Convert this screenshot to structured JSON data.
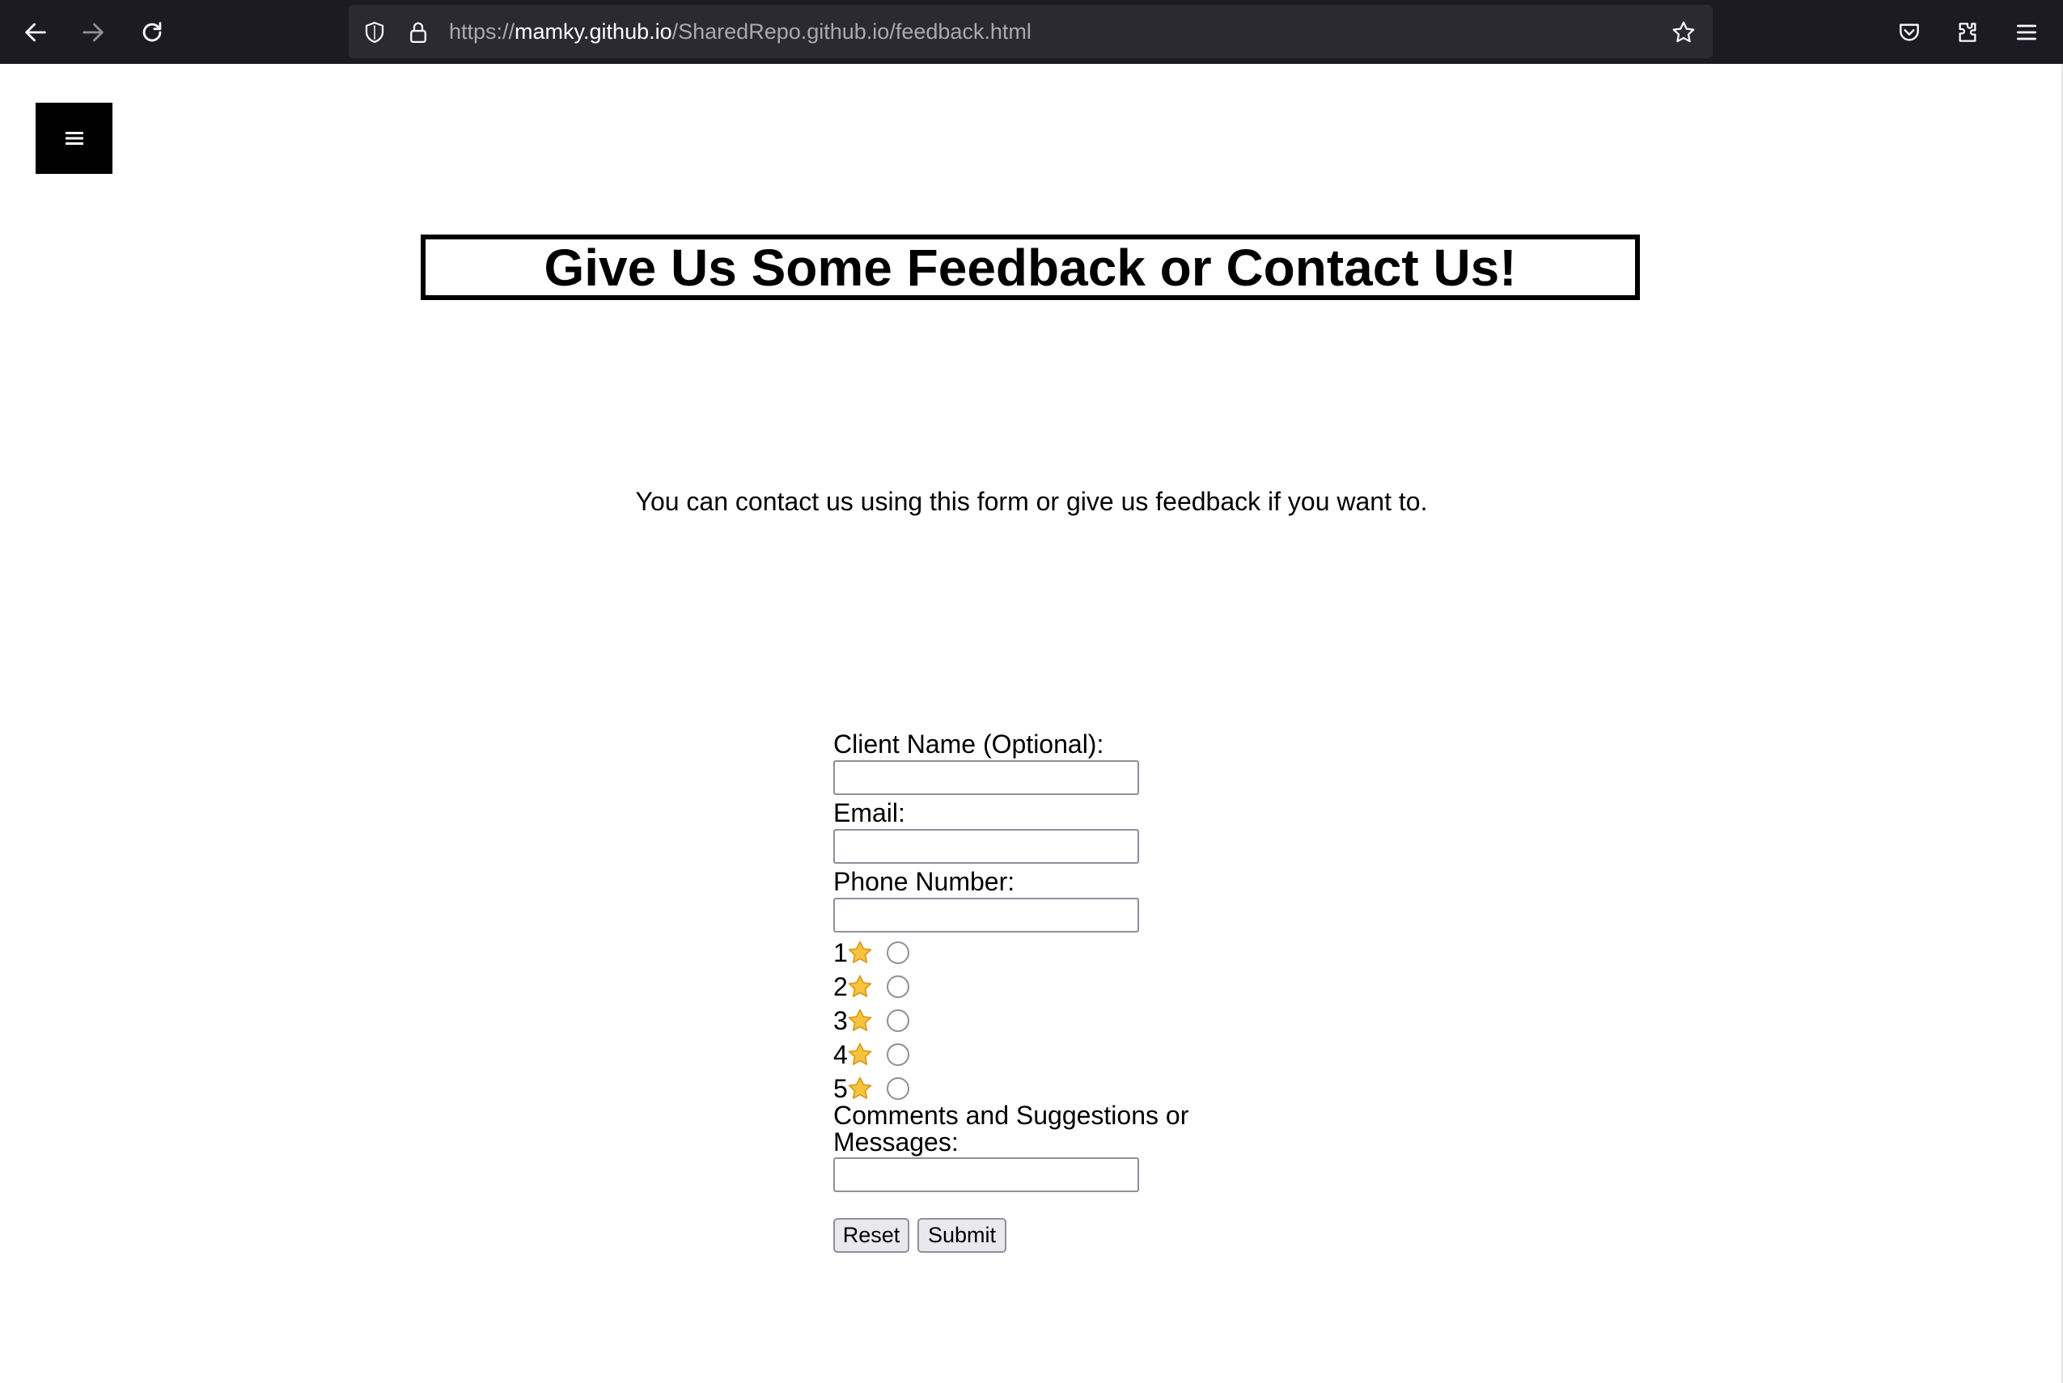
{
  "browser": {
    "url_scheme": "https://",
    "url_domain": "mamky.github.io",
    "url_path": "/SharedRepo.github.io/feedback.html"
  },
  "page": {
    "menu_icon": "hamburger-icon",
    "title": "Give Us Some Feedback or Contact Us!",
    "intro": "You can contact us using this form or give us feedback if you want to."
  },
  "form": {
    "name_label": "Client Name (Optional):",
    "name_value": "",
    "email_label": "Email:",
    "email_value": "",
    "phone_label": "Phone Number:",
    "phone_value": "",
    "ratings": [
      {
        "number": "1",
        "icon": "star-icon"
      },
      {
        "number": "2",
        "icon": "star-icon"
      },
      {
        "number": "3",
        "icon": "star-icon"
      },
      {
        "number": "4",
        "icon": "star-icon"
      },
      {
        "number": "5",
        "icon": "star-icon"
      }
    ],
    "comments_label": "Comments and Suggestions or Messages:",
    "comments_value": "",
    "reset_label": "Reset",
    "submit_label": "Submit"
  },
  "colors": {
    "toolbar_bg": "#1c1b22",
    "urlbar_bg": "#2b2a33",
    "star": "#f6c33a"
  }
}
